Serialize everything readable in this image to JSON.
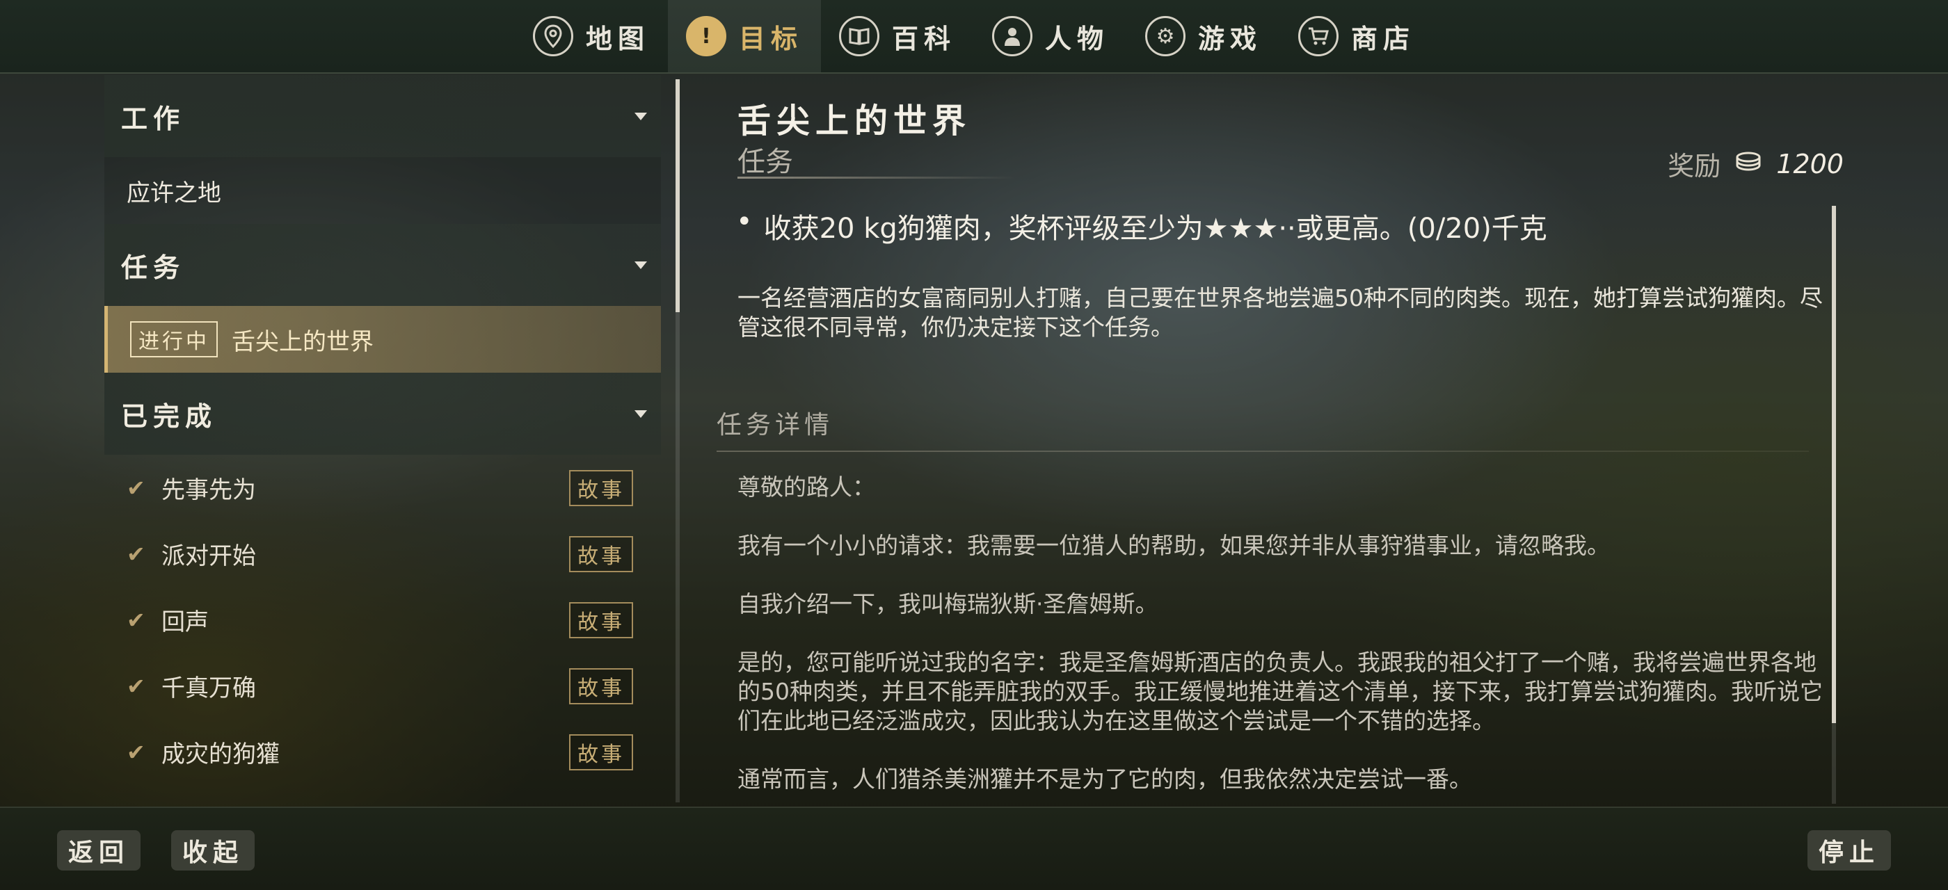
{
  "nav": {
    "tabs": [
      {
        "label": "地图",
        "icon": "map-pin-icon"
      },
      {
        "label": "目标",
        "icon": "exclamation-icon"
      },
      {
        "label": "百科",
        "icon": "book-icon"
      },
      {
        "label": "人物",
        "icon": "person-icon"
      },
      {
        "label": "游戏",
        "icon": "gear-icon"
      },
      {
        "label": "商店",
        "icon": "cart-icon"
      }
    ],
    "active": "目标"
  },
  "left": {
    "work_header": "工作",
    "work_items": [
      "应许之地"
    ],
    "missions_header": "任务",
    "active_mission": {
      "badge": "进行中",
      "label": "舌尖上的世界"
    },
    "completed_header": "已完成",
    "completed_items": [
      {
        "label": "先事先为",
        "tag": "故事"
      },
      {
        "label": "派对开始",
        "tag": "故事"
      },
      {
        "label": "回声",
        "tag": "故事"
      },
      {
        "label": "千真万确",
        "tag": "故事"
      },
      {
        "label": "成灾的狗獾",
        "tag": "故事"
      }
    ]
  },
  "detail": {
    "title": "舌尖上的世界",
    "subtitle": "任务",
    "reward_label": "奖励",
    "reward_value": "1200",
    "objective": "收获20 kg狗獾肉，奖杯评级至少为★★★··或更高。(0/20)千克",
    "summary": "一名经营酒店的女富商同别人打赌，自己要在世界各地尝遍50种不同的肉类。现在，她打算尝试狗獾肉。尽管这很不同寻常，你仍决定接下这个任务。",
    "details_label": "任务详情",
    "letter": [
      "尊敬的路人：",
      "我有一个小小的请求：我需要一位猎人的帮助，如果您并非从事狩猎事业，请忽略我。",
      "自我介绍一下，我叫梅瑞狄斯·圣詹姆斯。",
      "是的，您可能听说过我的名字：我是圣詹姆斯酒店的负责人。我跟我的祖父打了一个赌，我将尝遍世界各地的50种肉类，并且不能弄脏我的双手。我正缓慢地推进着这个清单，接下来，我打算尝试狗獾肉。我听说它们在此地已经泛滥成灾，因此我认为在这里做这个尝试是一个不错的选择。",
      "通常而言，人们猎杀美洲獾并不是为了它的肉，但我依然决定尝试一番。"
    ]
  },
  "bottom": {
    "back": "返回",
    "collapse": "收起",
    "stop": "停止"
  },
  "colors": {
    "accent_gold": "#d9b56a",
    "active_row": "#96825a",
    "nav_bg": "#1f2a22"
  }
}
